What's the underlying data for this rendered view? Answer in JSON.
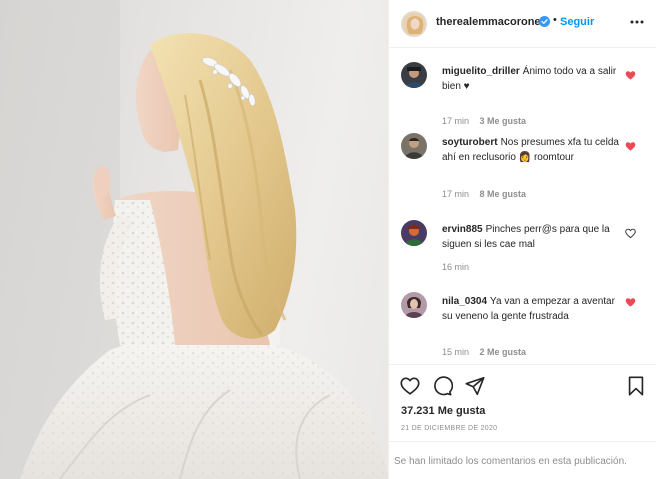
{
  "post": {
    "username": "therealemmacoronel",
    "follow_label": "Seguir",
    "separator": "•",
    "likes": "37.231 Me gusta",
    "date": "21 DE DICIEMBRE DE 2020",
    "comments_limited": "Se han limitado los comentarios en esta publicación."
  },
  "comments": [
    {
      "user": "miguelito_driller",
      "text": "Ánimo todo va a salir bien ♥",
      "time": "17 min",
      "likes": "3 Me gusta",
      "liked": true
    },
    {
      "user": "soyturobert",
      "text": "Nos presumes xfa tu celda ahí en reclusorio 👩 roomtour",
      "time": "17 min",
      "likes": "8 Me gusta",
      "liked": true
    },
    {
      "user": "ervin885",
      "text": "Pinches perr@s para que la siguen si les cae mal",
      "time": "16 min",
      "likes": "",
      "liked": false
    },
    {
      "user": "nila_0304",
      "text": "Ya van a empezar a aventar su veneno la gente frustrada",
      "time": "15 min",
      "likes": "2 Me gusta",
      "liked": true
    }
  ],
  "icons": {
    "verified": "verified-badge-icon",
    "more": "more-options-icon",
    "like": "heart-icon",
    "comment": "comment-bubble-icon",
    "share": "paper-plane-icon",
    "save": "bookmark-icon"
  },
  "colors": {
    "accent": "#0095f6",
    "liked_heart": "#ed4956",
    "muted_text": "#8e8e8e",
    "text": "#262626"
  }
}
